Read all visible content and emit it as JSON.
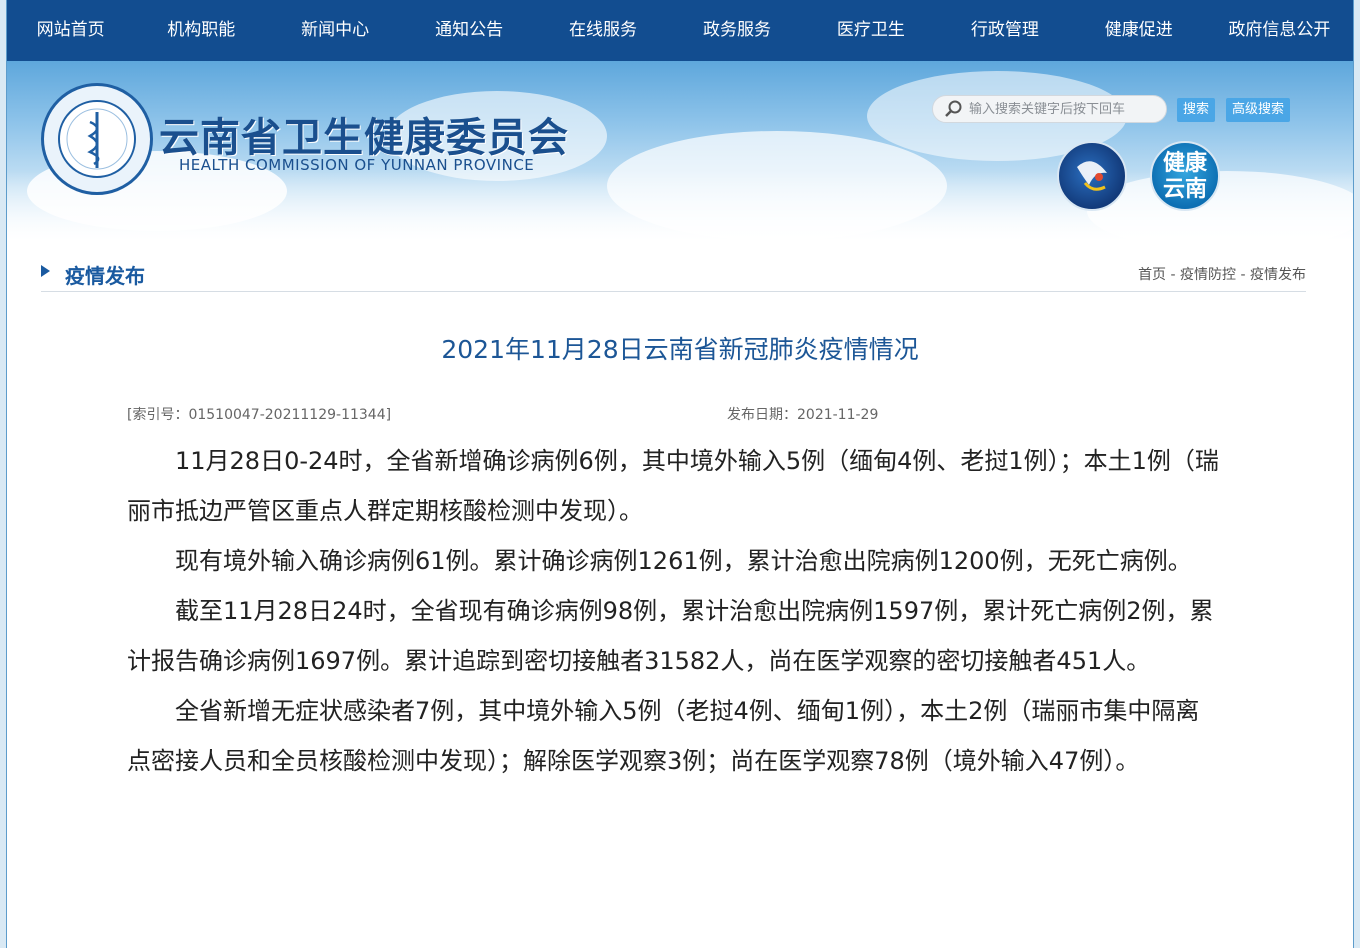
{
  "nav": {
    "items": [
      "网站首页",
      "机构职能",
      "新闻中心",
      "通知公告",
      "在线服务",
      "政务服务",
      "医疗卫生",
      "行政管理",
      "健康促进",
      "政府信息公开"
    ]
  },
  "header": {
    "title": "云南省卫生健康委员会",
    "subtitle": "HEALTH COMMISSION OF YUNNAN PROVINCE",
    "search_placeholder": "输入搜索关键字后按下回车",
    "search_button": "搜索",
    "advanced_search_button": "高级搜索",
    "badge_health": "健康\n云南"
  },
  "section": {
    "title": "疫情发布",
    "breadcrumb": [
      "首页",
      "疫情防控",
      "疫情发布"
    ]
  },
  "article": {
    "title": "2021年11月28日云南省新冠肺炎疫情情况",
    "index": "[索引号：01510047-20211129-11344]",
    "date": "发布日期：2021-11-29",
    "paragraphs": [
      "11月28日0-24时，全省新增确诊病例6例，其中境外输入5例（缅甸4例、老挝1例）；本土1例（瑞丽市抵边严管区重点人群定期核酸检测中发现）。",
      "现有境外输入确诊病例61例。累计确诊病例1261例，累计治愈出院病例1200例，无死亡病例。",
      "截至11月28日24时，全省现有确诊病例98例，累计治愈出院病例1597例，累计死亡病例2例，累计报告确诊病例1697例。累计追踪到密切接触者31582人，尚在医学观察的密切接触者451人。",
      "全省新增无症状感染者7例，其中境外输入5例（老挝4例、缅甸1例），本土2例（瑞丽市集中隔离点密接人员和全员核酸检测中发现）；解除医学观察3例；尚在医学观察78例（境外输入47例）。"
    ]
  },
  "colors": {
    "nav_bg": "#124d90",
    "accent": "#1a5aa0",
    "title_blue": "#1c5696",
    "button_blue": "#4aa6e6"
  }
}
